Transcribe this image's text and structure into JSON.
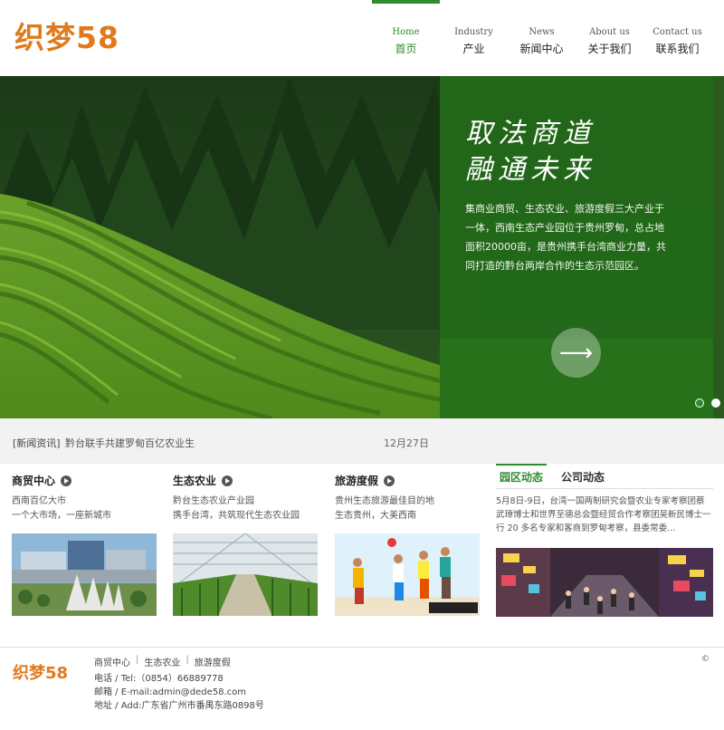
{
  "logo": {
    "text": "织梦58",
    "color": "#e07a1c"
  },
  "nav": {
    "items": [
      {
        "en": "Home",
        "zh": "首页",
        "active": true
      },
      {
        "en": "Industry",
        "zh": "产业",
        "active": false
      },
      {
        "en": "News",
        "zh": "新闻中心",
        "active": false
      },
      {
        "en": "About us",
        "zh": "关于我们",
        "active": false
      },
      {
        "en": "Contact us",
        "zh": "联系我们",
        "active": false
      }
    ]
  },
  "banner": {
    "slogan_line1": "取法商道",
    "slogan_line2": "融通未来",
    "intro": "集商业商贸、生态农业、旅游度假三大产业于一体，西南生态产业园位于贵州罗甸，总占地面积20000亩，是贵州携手台湾商业力量，共同打造的黔台两岸合作的生态示范园区。",
    "arrow": "⟶",
    "slides": 2,
    "active_slide": 1
  },
  "ticker": {
    "tag": "[新闻资讯]",
    "title": "黔台联手共建罗甸百亿农业生",
    "date": "12月27日"
  },
  "columns": [
    {
      "title": "商贸中心",
      "line1": "西南百亿大市",
      "line2": "一个大市场，一座新城市",
      "icon": "play-circle-icon",
      "image": "commercial-complex-photo"
    },
    {
      "title": "生态农业",
      "line1": "黔台生态农业产业园",
      "line2": "携手台湾，共筑现代生态农业园",
      "icon": "play-circle-icon",
      "image": "greenhouse-photo"
    },
    {
      "title": "旅游度假",
      "line1": "贵州生态旅游最佳目的地",
      "line2": "生态贵州，大美西南",
      "icon": "play-circle-icon",
      "image": "beach-volleyball-photo"
    }
  ],
  "tabs": {
    "items": [
      {
        "label": "园区动态",
        "active": true
      },
      {
        "label": "公司动态",
        "active": false
      }
    ],
    "text": "5月8日-9日，台湾一国两制研究会暨农业专家考察团蔡武璋博士和世界至德总会暨经贸合作考察团吴新民博士一行 20 多名专家和客商到罗甸考察，县委常委...",
    "image": "night-market-photo"
  },
  "footer": {
    "logo": "织梦58",
    "links": [
      "商贸中心",
      "生态农业",
      "旅游度假"
    ],
    "sep": "|",
    "phone": "电话 / Tel:（0854）66889778",
    "email": "邮箱 / E-mail:admin@dede58.com",
    "address": "地址 / Add:广东省广州市番禺东路0898号",
    "copyright": "©"
  },
  "colors": {
    "accent_green": "#2e8b2e",
    "panel_green": "#226c1a",
    "logo_orange": "#e07a1c"
  }
}
